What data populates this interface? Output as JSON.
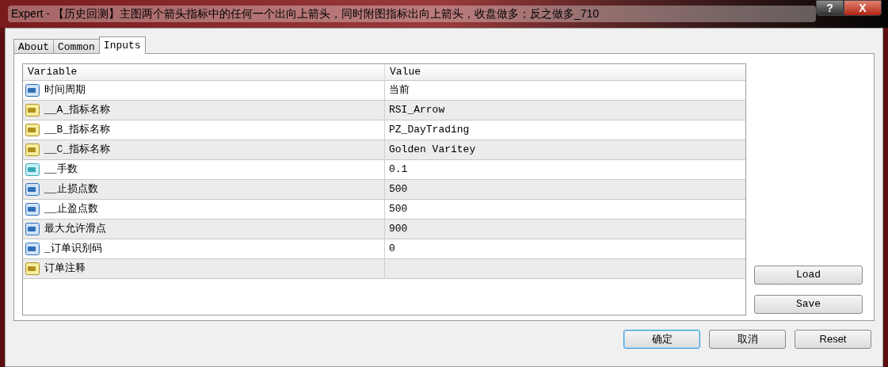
{
  "window": {
    "title": "Expert - 【历史回测】主图两个箭头指标中的任何一个出向上箭头，同时附图指标出向上箭头，收盘做多；反之做多_710",
    "help_button": "?",
    "close_button": "X"
  },
  "tabs": [
    {
      "label": "About",
      "selected": false
    },
    {
      "label": "Common",
      "selected": false
    },
    {
      "label": "Inputs",
      "selected": true
    }
  ],
  "table": {
    "columns": [
      "Variable",
      "Value"
    ],
    "rows": [
      {
        "kind": "int",
        "variable": "时间周期",
        "value": "当前"
      },
      {
        "kind": "string",
        "variable": "__A_指标名称",
        "value": "RSI_Arrow"
      },
      {
        "kind": "string",
        "variable": "__B_指标名称",
        "value": "PZ_DayTrading"
      },
      {
        "kind": "string",
        "variable": "__C_指标名称",
        "value": "Golden Varitey"
      },
      {
        "kind": "double",
        "variable": "__手数",
        "value": "0.1"
      },
      {
        "kind": "int",
        "variable": "__止损点数",
        "value": "500"
      },
      {
        "kind": "int",
        "variable": "__止盈点数",
        "value": "500"
      },
      {
        "kind": "int",
        "variable": "最大允许滑点",
        "value": "900"
      },
      {
        "kind": "int",
        "variable": "_订单识别码",
        "value": "0"
      },
      {
        "kind": "string",
        "variable": "订单注释"
      }
    ]
  },
  "side_buttons": [
    "Load",
    "Save"
  ],
  "bottom_buttons": [
    {
      "label": "确定",
      "default": true
    },
    {
      "label": "取消",
      "default": false
    },
    {
      "label": "Reset",
      "default": false
    }
  ]
}
